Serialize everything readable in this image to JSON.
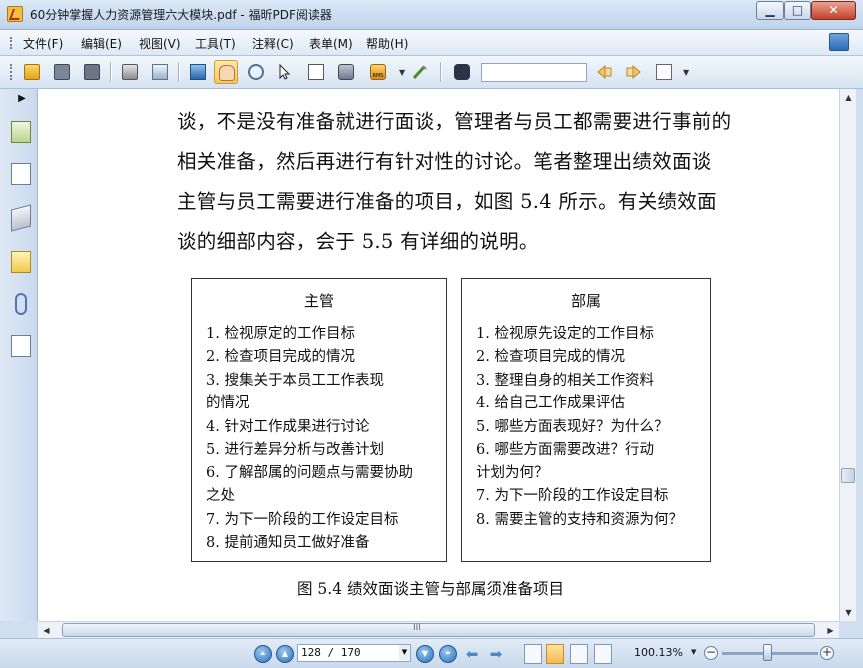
{
  "window": {
    "title": "60分钟掌握人力资源管理六大模块.pdf - 福昕PDF阅读器",
    "minimize_label": "▁",
    "maximize_label": "□",
    "close_label": "✕"
  },
  "menu": {
    "items": [
      {
        "label": "文件(F)"
      },
      {
        "label": "编辑(E)"
      },
      {
        "label": "视图(V)"
      },
      {
        "label": "工具(T)"
      },
      {
        "label": "注释(C)"
      },
      {
        "label": "表单(M)"
      },
      {
        "label": "帮助(H)"
      }
    ]
  },
  "toolbar": {
    "icons": [
      "open-folder-icon",
      "save-icon",
      "save-as-icon",
      "print-icon",
      "scan-icon",
      "fullscreen-icon",
      "hand-tool-icon",
      "zoom-icon",
      "select-arrow-icon",
      "text-select-icon",
      "snapshot-icon",
      "rms-lock-icon",
      "sign-icon",
      "binoculars-icon",
      "find-previous-icon",
      "find-next-icon",
      "search-options-icon"
    ],
    "active_tool": "hand-tool-icon",
    "rms_text": "RMS",
    "search_value": ""
  },
  "document": {
    "paragraph": [
      "谈，不是没有准备就进行面谈，管理者与员工都需要进行事前的",
      "相关准备，然后再进行有针对性的讨论。笔者整理出绩效面谈",
      "主管与员工需要进行准备的项目，如图 5.4 所示。有关绩效面",
      "谈的细部内容，会于 5.5 有详细的说明。"
    ],
    "manager_box": {
      "title": "主管",
      "lines": [
        "1.  检视原定的工作目标",
        "2.  检查项目完成的情况",
        "3.  搜集关于本员工工作表现",
        "     的情况",
        "4.  针对工作成果进行讨论",
        "5.  进行差异分析与改善计划",
        "6.  了解部属的问题点与需要协助",
        "     之处",
        "7.  为下一阶段的工作设定目标",
        "8.  提前通知员工做好准备"
      ]
    },
    "subordinate_box": {
      "title": "部属",
      "lines": [
        "1.  检视原先设定的工作目标",
        "2.  检查项目完成的情况",
        "3.  整理自身的相关工作资料",
        "4.  给自己工作成果评估",
        "5.  哪些方面表现好？为什么？",
        "6.  哪些方面需要改进？行动",
        "     计划为何？",
        "7.  为下一阶段的工作设定目标",
        "8.  需要主管的支持和资源为何？"
      ]
    },
    "caption": "图 5.4    绩效面谈主管与部属须准备项目"
  },
  "statusbar": {
    "page_display": "128 / 170",
    "zoom": "100.13%",
    "zoom_out_label": "−",
    "zoom_in_label": "+"
  },
  "scrollbar": {
    "vertical_position": 0.75,
    "h_grip": "III"
  },
  "colors": {
    "chrome": "#cfdff0",
    "page": "#ffffff",
    "text": "#111111",
    "accent": "#2d6fb8"
  }
}
